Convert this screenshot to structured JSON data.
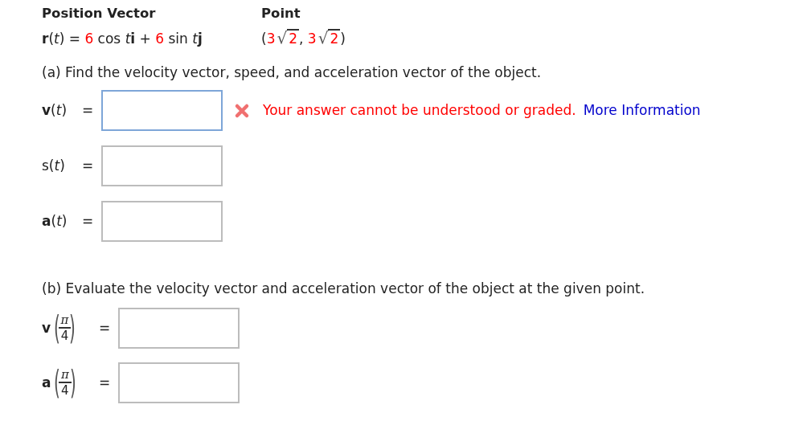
{
  "header": {
    "columns": [
      "Position Vector",
      "Point"
    ]
  },
  "position": [
    {
      "kind": "bold",
      "text": "r"
    },
    {
      "kind": "plain",
      "text": "("
    },
    {
      "kind": "italic",
      "text": "t"
    },
    {
      "kind": "plain",
      "text": ") = "
    },
    {
      "kind": "number",
      "text": "6"
    },
    {
      "kind": "plain",
      "text": " cos "
    },
    {
      "kind": "italic",
      "text": "t"
    },
    {
      "kind": "bold",
      "text": "i"
    },
    {
      "kind": "plain",
      "text": " + "
    },
    {
      "kind": "number",
      "text": "6"
    },
    {
      "kind": "plain",
      "text": " sin "
    },
    {
      "kind": "italic",
      "text": "t"
    },
    {
      "kind": "bold",
      "text": "j"
    }
  ],
  "point": [
    {
      "kind": "plain",
      "text": "("
    },
    {
      "kind": "number",
      "text": "3"
    },
    {
      "kind": "radical",
      "text": "√"
    },
    {
      "kind": "radicand",
      "text": "2"
    },
    {
      "kind": "plain",
      "text": ", "
    },
    {
      "kind": "number",
      "text": "3"
    },
    {
      "kind": "radical",
      "text": "√"
    },
    {
      "kind": "radicand",
      "text": "2"
    },
    {
      "kind": "plain",
      "text": ")"
    }
  ],
  "part_a": {
    "prompt": "(a) Find the velocity vector, speed, and acceleration vector of the object.",
    "rows": [
      {
        "label": [
          {
            "kind": "bold",
            "text": "v"
          },
          {
            "kind": "plain",
            "text": "("
          },
          {
            "kind": "italic",
            "text": "t"
          },
          {
            "kind": "plain",
            "text": ")"
          }
        ],
        "equals": "=",
        "focused": true,
        "error": {
          "message": "Your answer cannot be understood or graded.",
          "link": "More Information"
        }
      },
      {
        "label": [
          {
            "kind": "plain",
            "text": "s"
          },
          {
            "kind": "plain",
            "text": "("
          },
          {
            "kind": "italic",
            "text": "t"
          },
          {
            "kind": "plain",
            "text": ")"
          }
        ],
        "equals": "=",
        "focused": false
      },
      {
        "label": [
          {
            "kind": "bold",
            "text": "a"
          },
          {
            "kind": "plain",
            "text": "("
          },
          {
            "kind": "italic",
            "text": "t"
          },
          {
            "kind": "plain",
            "text": ")"
          }
        ],
        "equals": "=",
        "focused": false
      }
    ]
  },
  "part_b": {
    "prompt": "(b) Evaluate the velocity vector and acceleration vector of the object at the given point.",
    "rows": [
      {
        "name": "v",
        "open": "(",
        "numerator": "π",
        "denominator": "4",
        "close": ")",
        "equals": "=",
        "focused": false
      },
      {
        "name": "a",
        "open": "(",
        "numerator": "π",
        "denominator": "4",
        "close": ")",
        "equals": "=",
        "focused": false
      }
    ]
  }
}
